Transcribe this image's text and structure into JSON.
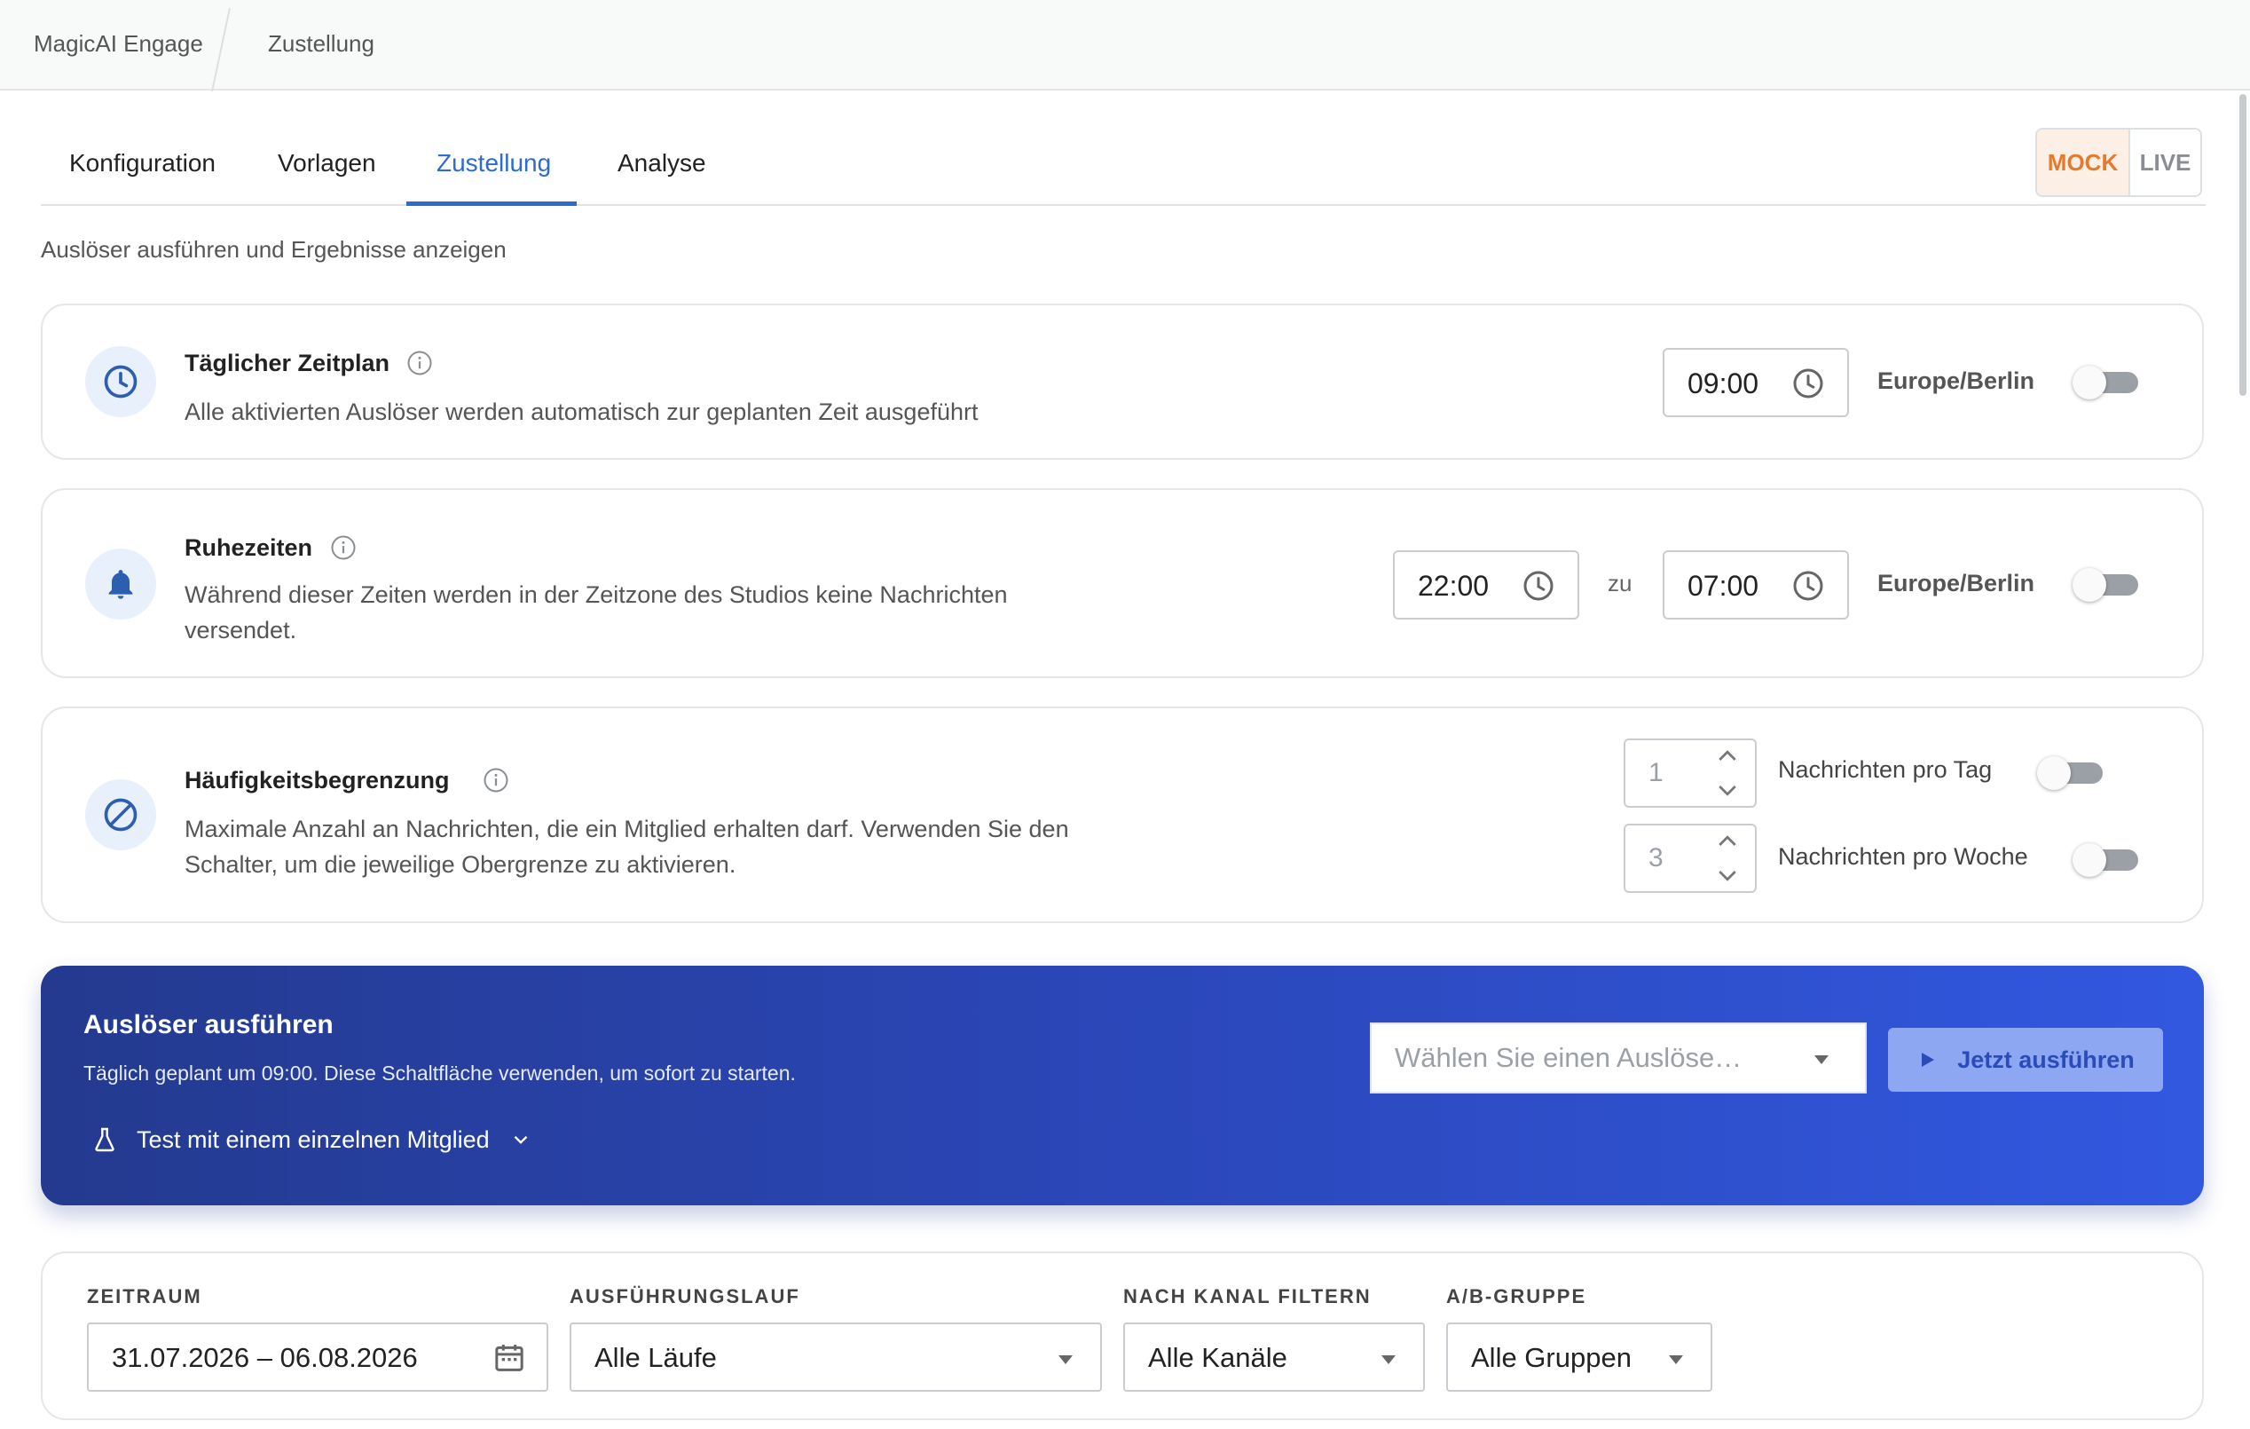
{
  "breadcrumb": {
    "app": "MagicAI Engage",
    "page": "Zustellung"
  },
  "tabs": [
    {
      "label": "Konfiguration"
    },
    {
      "label": "Vorlagen"
    },
    {
      "label": "Zustellung"
    },
    {
      "label": "Analyse"
    }
  ],
  "active_tab": "Zustellung",
  "mode": {
    "mock": "MOCK",
    "live": "LIVE",
    "selected": "MOCK"
  },
  "subtitle": "Auslöser ausführen und Ergebnisse anzeigen",
  "schedule": {
    "title": "Täglicher Zeitplan",
    "desc": "Alle aktivierten Auslöser werden automatisch zur geplanten Zeit ausgeführt",
    "time": "09:00",
    "timezone": "Europe/Berlin",
    "enabled": false
  },
  "quiet": {
    "title": "Ruhezeiten",
    "desc_line1": "Während dieser Zeiten werden in der Zeitzone des Studios keine Nachrichten",
    "desc_line2": "versendet.",
    "from": "22:00",
    "to_label": "zu",
    "to": "07:00",
    "timezone": "Europe/Berlin",
    "enabled": false
  },
  "limit": {
    "title": "Häufigkeitsbegrenzung",
    "desc_line1": "Maximale Anzahl an Nachrichten, die ein Mitglied erhalten darf. Verwenden Sie den",
    "desc_line2": "Schalter, um die jeweilige Obergrenze zu aktivieren.",
    "per_day_value": "1",
    "per_day_label": "Nachrichten pro Tag",
    "per_week_value": "3",
    "per_week_label": "Nachrichten pro Woche"
  },
  "run": {
    "title": "Auslöser ausführen",
    "desc": "Täglich geplant um 09:00. Diese Schaltfläche verwenden, um sofort zu starten.",
    "test_label": "Test mit einem einzelnen Mitglied",
    "select_placeholder": "Wählen Sie einen Auslöse…",
    "button": "Jetzt ausführen"
  },
  "filters": {
    "period_label": "ZEITRAUM",
    "period_value": "31.07.2026 – 06.08.2026",
    "run_label": "AUSFÜHRUNGSLAUF",
    "run_value": "Alle Läufe",
    "channel_label": "NACH KANAL FILTERN",
    "channel_value": "Alle Kanäle",
    "group_label": "A/B-GRUPPE",
    "group_value": "Alle Gruppen"
  },
  "colors": {
    "accent": "#2d6bd0",
    "mock": "#e57a2c",
    "run_gradient_start": "#243a8f",
    "run_gradient_end": "#3258e0"
  }
}
